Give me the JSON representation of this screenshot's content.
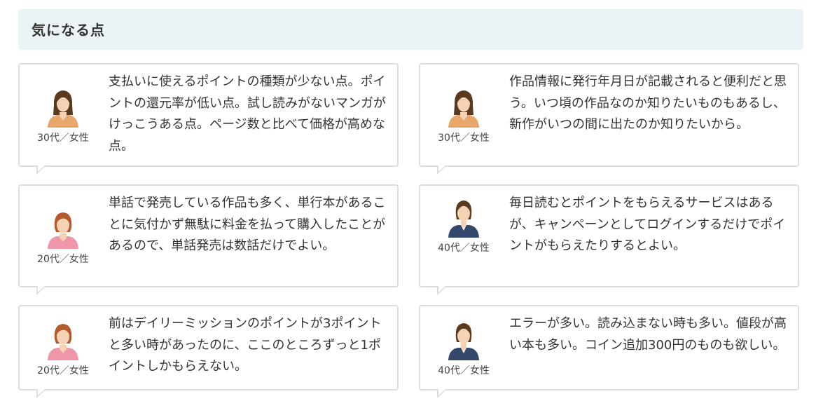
{
  "section": {
    "title": "気になる点"
  },
  "reviews": [
    {
      "avatar": "female-orange-avatar-icon",
      "age": "30代／女性",
      "comment": "支払いに使えるポイントの種類が少ない点。ポイントの還元率が低い点。試し読みがないマンガがけっこうある点。ページ数と比べて価格が高めな点。"
    },
    {
      "avatar": "female-orange-avatar-icon",
      "age": "30代／女性",
      "comment": "作品情報に発行年月日が記載されると便利だと思う。いつ頃の作品なのか知りたいものもあるし、新作がいつの間に出たのか知りたいから。"
    },
    {
      "avatar": "female-pink-avatar-icon",
      "age": "20代／女性",
      "comment": "単話で発売している作品も多く、単行本があることに気付かず無駄に料金を払って購入したことがあるので、単話発売は数話だけでよい。"
    },
    {
      "avatar": "female-navy-avatar-icon",
      "age": "40代／女性",
      "comment": "毎日読むとポイントをもらえるサービスはあるが、キャンペーンとしてログインするだけでポイントがもらえたりするとよい。"
    },
    {
      "avatar": "female-pink-avatar-icon",
      "age": "20代／女性",
      "comment": "前はデイリーミッションのポイントが3ポイントと多い時があったのに、ここのところずっと1ポイントしかもらえない。"
    },
    {
      "avatar": "female-navy-avatar-icon",
      "age": "40代／女性",
      "comment": "エラーが多い。読み込まない時も多い。値段が高い本も多い。コイン追加300円のものも欲しい。"
    }
  ],
  "colors": {
    "header_bg": "#eaf3f6",
    "border": "#dddddd",
    "orange_top": "#e8a66a",
    "pink_top": "#ef97a8",
    "navy_top": "#34486b",
    "hair_dark": "#5a3a1e",
    "hair_red": "#b5592e",
    "skin": "#f4d2b3"
  }
}
